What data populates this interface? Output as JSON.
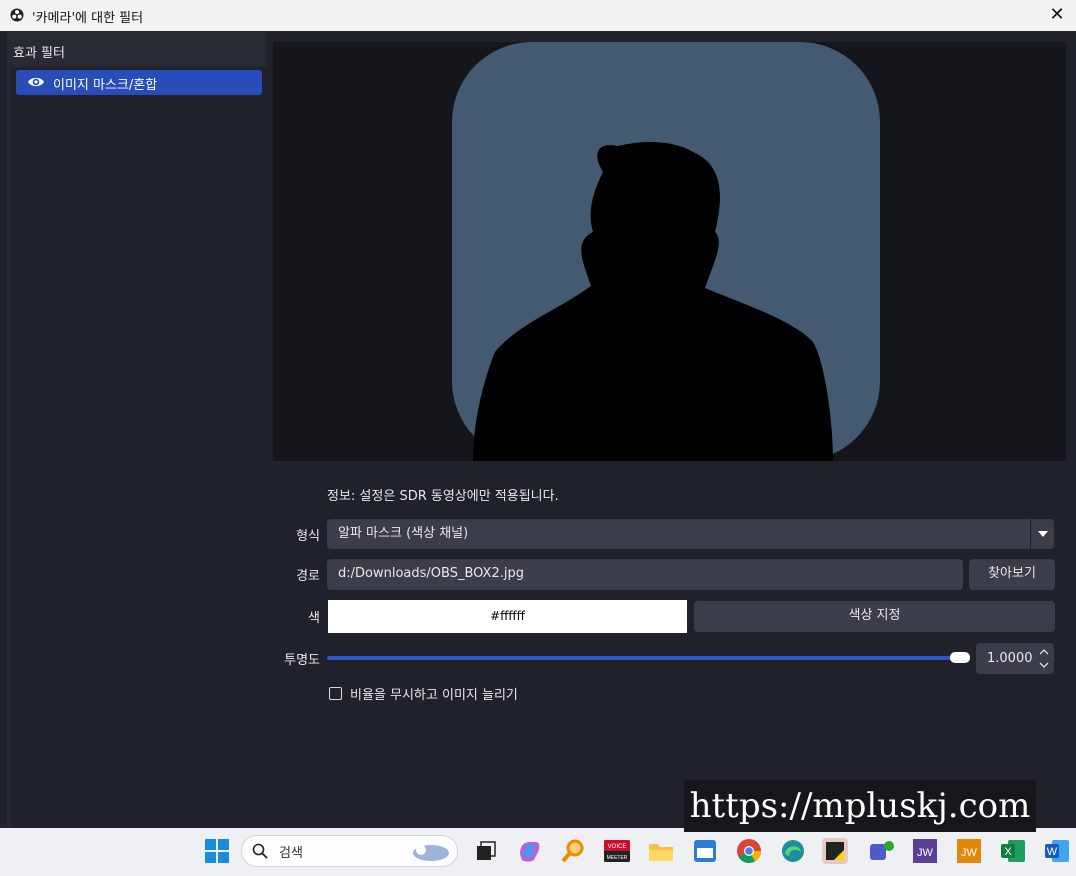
{
  "window": {
    "title": "'카메라'에 대한 필터",
    "close_label": "✕"
  },
  "left_panel": {
    "heading": "효과 필터",
    "filters": [
      {
        "label": "이미지 마스크/혼합",
        "visible_icon": "eye-icon"
      }
    ]
  },
  "settings": {
    "info": "정보: 설정은 SDR 동영상에만 적용됩니다.",
    "type_label": "형식",
    "type_value": "알파 마스크 (색상 채널)",
    "path_label": "경로",
    "path_value": "d:/Downloads/OBS_BOX2.jpg",
    "browse_label": "찾아보기",
    "color_label": "색",
    "color_value": "#ffffff",
    "color_button_label": "색상 지정",
    "opacity_label": "투명도",
    "opacity_value": "1.0000",
    "opacity_fraction": 1.0,
    "stretch_label": "비율을 무시하고 이미지 늘리기",
    "stretch_checked": false
  },
  "taskbar": {
    "search_placeholder": "검색",
    "apps": [
      "windows-start",
      "task-view",
      "copilot",
      "search-tool",
      "voicemeeter",
      "file-explorer",
      "onenote",
      "chrome",
      "edge-alt",
      "sticky-notes",
      "teams",
      "jw-purple",
      "jw-orange",
      "excel",
      "word"
    ]
  },
  "watermark": "https://mpluskj.com",
  "colors": {
    "accent": "#284cb8",
    "slider": "#2f56c6",
    "preview_mask": "#435a70"
  }
}
